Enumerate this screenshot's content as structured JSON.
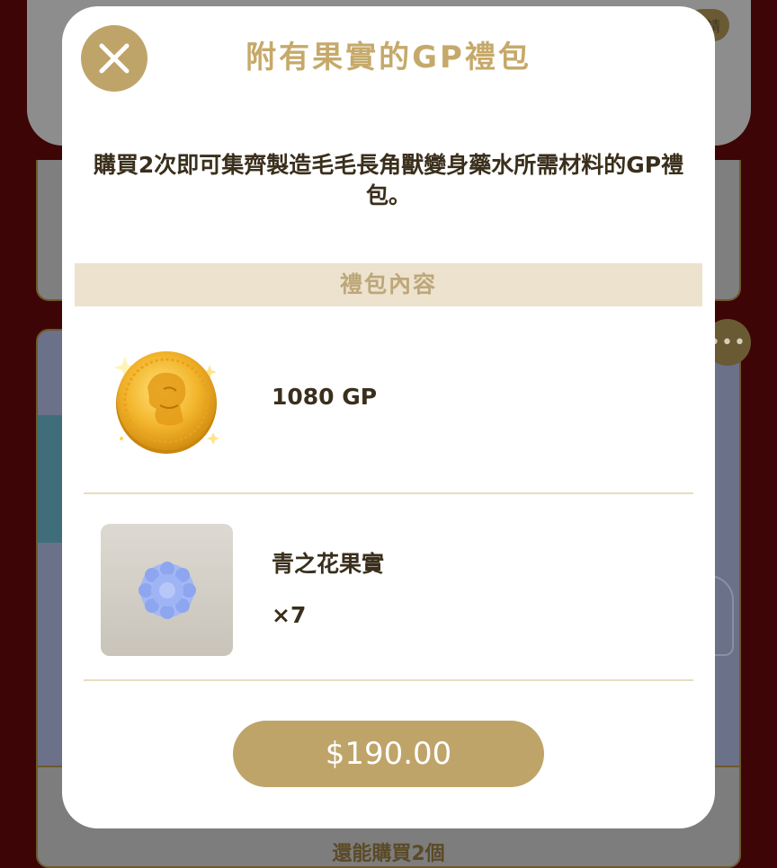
{
  "background": {
    "more_icon_glyph": "•••",
    "bottom_text": "還能購買2個",
    "top_pill_text": "請"
  },
  "modal": {
    "close_icon": "close-icon",
    "title": "附有果實的GP禮包",
    "description": "購買2次即可集齊製造毛毛長角獸變身藥水所需材料的GP禮包。",
    "section_header": "禮包內容",
    "items": [
      {
        "icon": "gold-coin-icon",
        "name": "1080 GP",
        "qty": ""
      },
      {
        "icon": "blue-flower-fruit-icon",
        "name": "青之花果實",
        "qty": "×7"
      }
    ],
    "price_label": "$190.00"
  },
  "colors": {
    "accent_gold": "#bfa46a",
    "title_gold": "#c6a96a",
    "section_bg": "#ece2cd",
    "text_dark": "#3a2f1c",
    "backdrop": "#3d0506"
  }
}
